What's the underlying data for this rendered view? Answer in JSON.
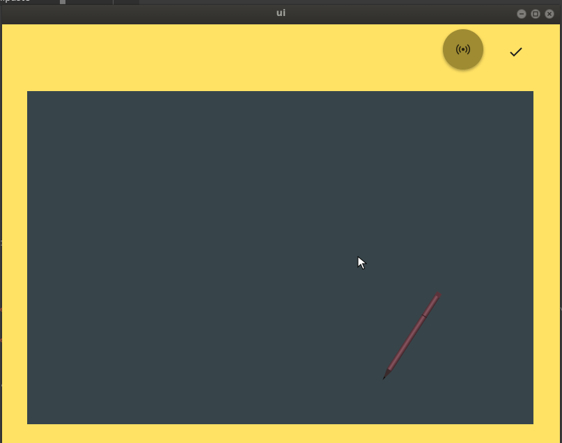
{
  "background": {
    "partial_text": "lipaste",
    "left_edge_marks": [
      "1",
      "e",
      "e",
      ","
    ],
    "right_edge_mark": "\\"
  },
  "window": {
    "title": "ui",
    "controls": [
      "minimize",
      "maximize",
      "close"
    ]
  },
  "toolbar": {
    "broadcast_icon": "broadcast-icon",
    "confirm_icon": "checkmark-icon"
  },
  "colors": {
    "window_background": "#ffe264",
    "canvas_background": "#37454a",
    "broadcast_button": "#9e8b32",
    "titlebar": "#3c3b37",
    "pen_body": "#6b3d44"
  }
}
